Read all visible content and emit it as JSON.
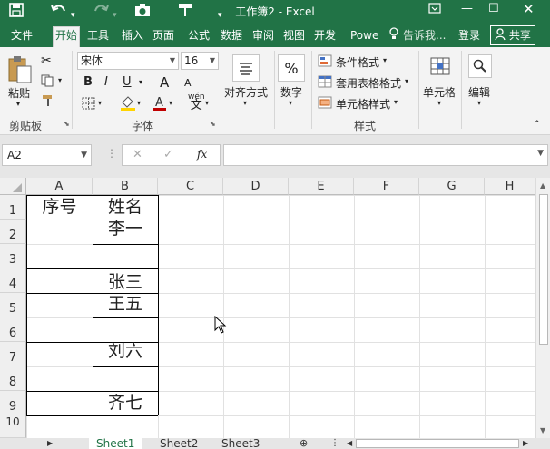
{
  "titlebar": {
    "title": "工作簿2 - Excel",
    "save_icon": "save-icon",
    "undo_icon": "undo-icon",
    "redo_icon": "redo-icon",
    "camera_icon": "camera-icon",
    "format_painter_icon": "paintbrush-icon"
  },
  "menu": {
    "items": [
      "文件",
      "开始",
      "工具",
      "插入",
      "页面",
      "公式",
      "数据",
      "审阅",
      "视图",
      "开发",
      "Powe"
    ],
    "tellme": "告诉我...",
    "login": "登录",
    "share": "共享"
  },
  "ribbon": {
    "clipboard": {
      "paste": "粘贴",
      "group": "剪贴板"
    },
    "font": {
      "name": "宋体",
      "size": "16",
      "bold": "B",
      "italic": "I",
      "underline": "U",
      "grow": "A",
      "shrink": "A",
      "group": "字体",
      "wen": "wén",
      "wen_char": "文"
    },
    "alignment": {
      "label": "对齐方式"
    },
    "number": {
      "label": "数字",
      "percent": "%"
    },
    "styles": {
      "conditional": "条件格式",
      "table": "套用表格格式",
      "cell": "单元格样式",
      "group": "样式"
    },
    "cells": {
      "label": "单元格"
    },
    "editing": {
      "label": "编辑"
    }
  },
  "formula_bar": {
    "name_box": "A2",
    "cancel": "✕",
    "confirm": "✓",
    "fx": "fx",
    "value": ""
  },
  "grid": {
    "columns": [
      "A",
      "B",
      "C",
      "D",
      "E",
      "F",
      "G",
      "H"
    ],
    "rows": [
      "1",
      "2",
      "3",
      "4",
      "5",
      "6",
      "7",
      "8",
      "9",
      "10"
    ],
    "cells": {
      "A1": "序号",
      "B1": "姓名",
      "B2": "李一",
      "B4": "张三",
      "B5": "王五",
      "B7": "刘六",
      "B9": "齐七"
    }
  },
  "sheets": {
    "tabs": [
      "Sheet1",
      "Sheet2",
      "Sheet3"
    ],
    "active": "Sheet1"
  },
  "colors": {
    "excel_green": "#217346",
    "ribbon_bg": "#f3f3f3",
    "header_bg": "#efefef"
  }
}
